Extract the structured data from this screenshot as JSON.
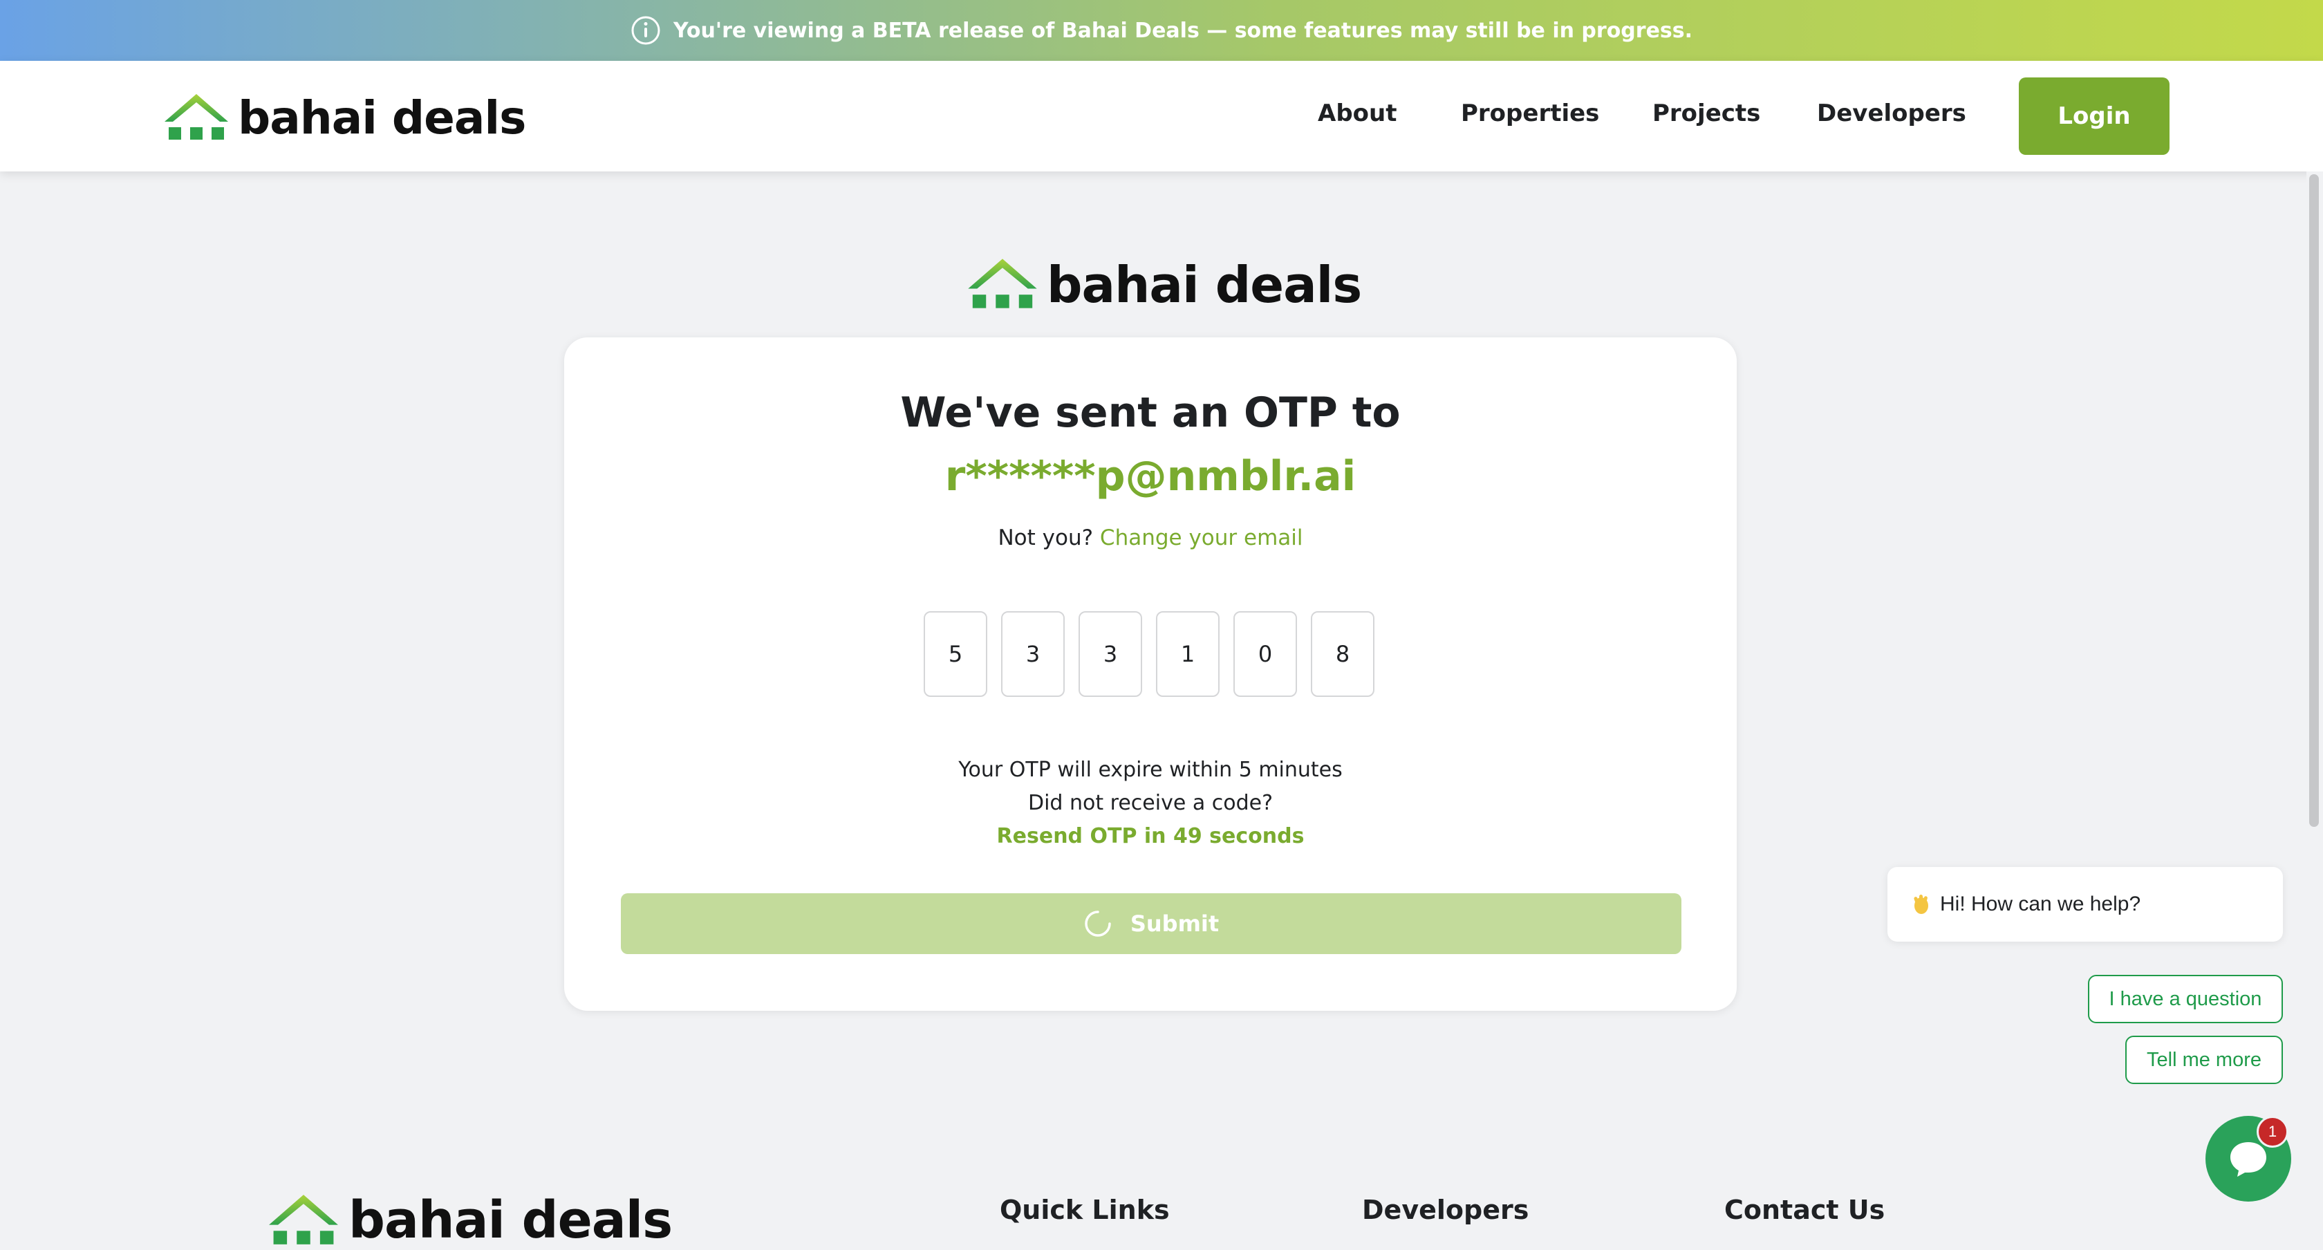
{
  "banner": {
    "icon": "info-icon",
    "text": "You're viewing a BETA release of Bahai Deals — some features may still be in progress."
  },
  "brand": {
    "name": "bahai deals",
    "primary_color": "#7aab2f",
    "logo_icon": "house-logo-icon"
  },
  "nav": {
    "items": [
      "About",
      "Properties",
      "Projects",
      "Developers"
    ],
    "login_label": "Login"
  },
  "otp": {
    "heading": "We've sent an OTP to",
    "email": "r******p@nmblr.ai",
    "not_you": "Not you?",
    "change_link": "Change your email",
    "digits": [
      "5",
      "3",
      "3",
      "1",
      "0",
      "8"
    ],
    "expire_text": "Your OTP will expire within 5 minutes",
    "not_received": "Did not receive a code?",
    "resend": "Resend OTP in 49 seconds",
    "submit_label": "Submit"
  },
  "chat": {
    "greeting": "Hi! How can we help?",
    "greeting_icon": "waving-hand-icon",
    "quick_replies": [
      "I have a question",
      "Tell me more"
    ],
    "unread_count": "1",
    "launcher_icon": "chat-icon"
  },
  "footer": {
    "headings": [
      "Quick Links",
      "Developers",
      "Contact Us"
    ]
  }
}
